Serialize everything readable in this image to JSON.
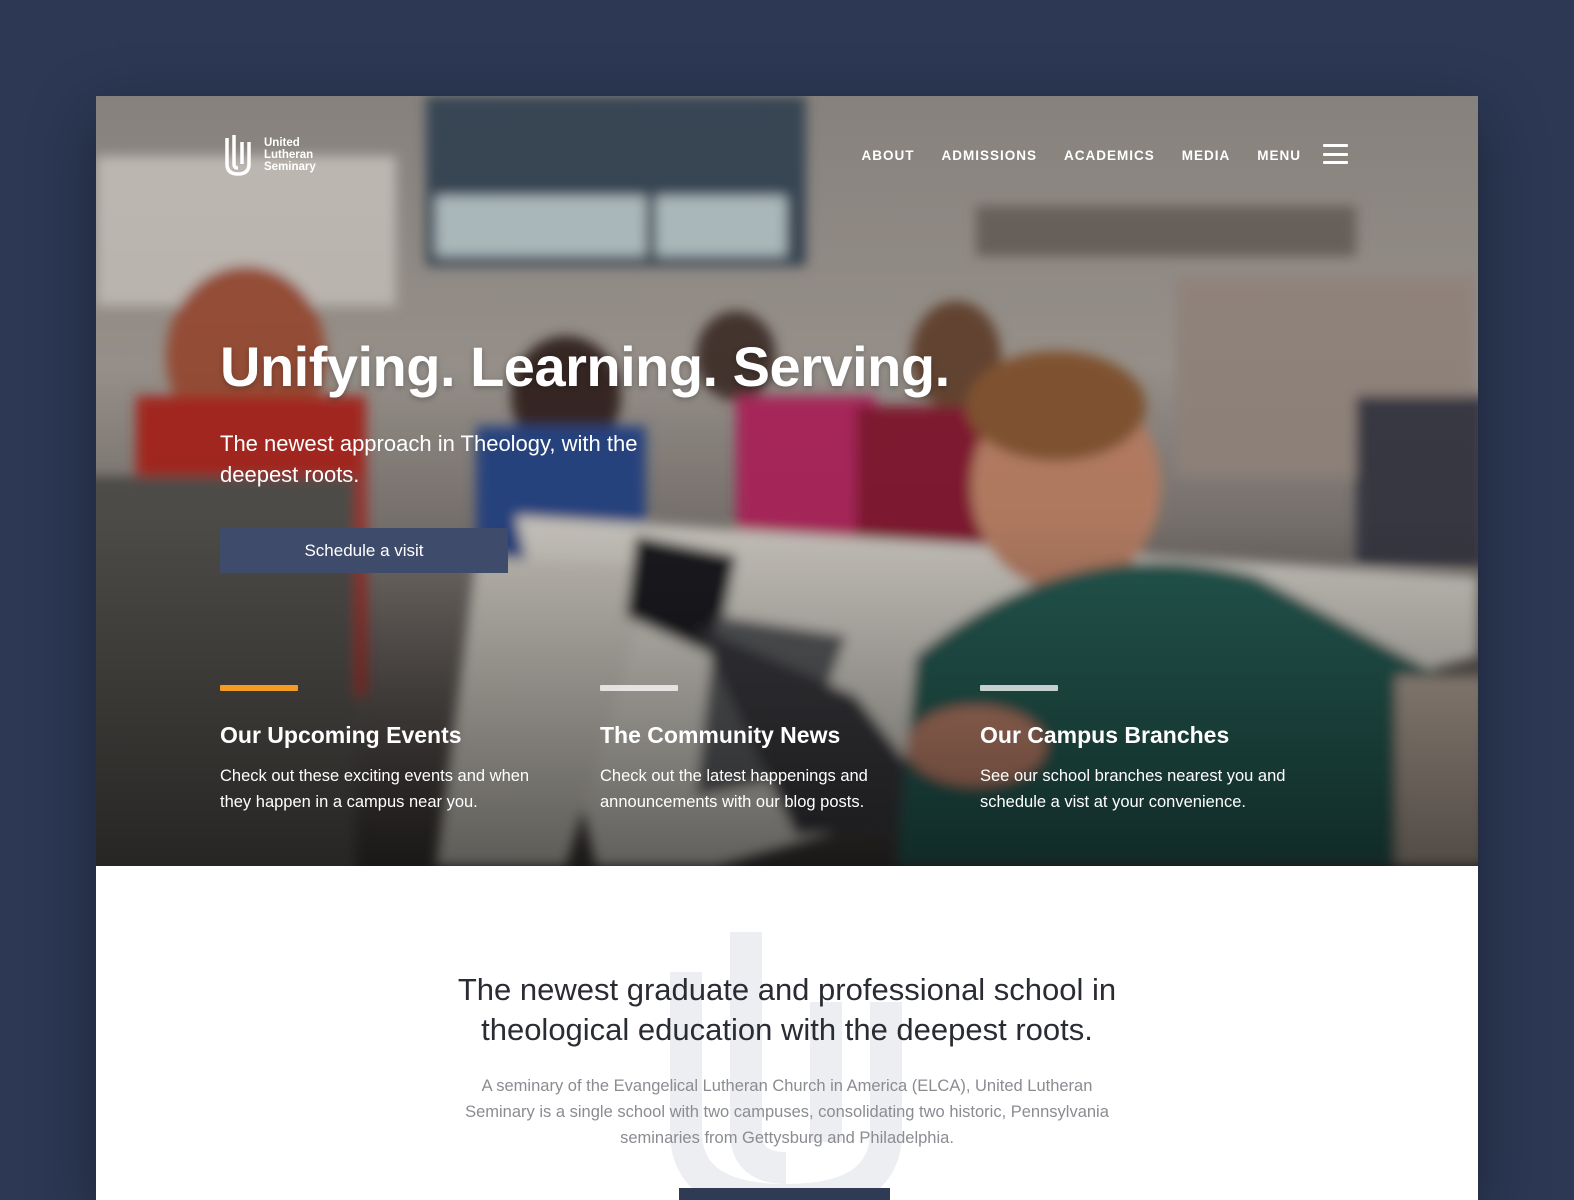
{
  "header": {
    "logo_text": [
      "United",
      "Lutheran",
      "Seminary"
    ],
    "nav": [
      {
        "label": "ABOUT"
      },
      {
        "label": "ADMISSIONS"
      },
      {
        "label": "ACADEMICS"
      },
      {
        "label": "MEDIA"
      }
    ],
    "menu_label": "MENU",
    "menu_icon": "hamburger-icon"
  },
  "hero": {
    "title": "Unifying. Learning. Serving.",
    "subtitle": "The newest approach in Theology, with the deepest roots.",
    "cta_label": "Schedule a visit"
  },
  "features": [
    {
      "title": "Our Upcoming Events",
      "description": "Check out these exciting events and when they happen in a campus near you.",
      "active": true
    },
    {
      "title": "The Community News",
      "description": "Check out the latest happenings and announcements with our blog posts.",
      "active": false
    },
    {
      "title": "Our Campus Branches",
      "description": "See our school branches nearest you and schedule a vist at your convenience.",
      "active": false
    }
  ],
  "intro": {
    "heading": "The newest graduate and professional school in theological education with the deepest roots.",
    "text": "A seminary of the Evangelical Lutheran Church in America (ELCA), United Lutheran Seminary is a single school with two campuses, consolidating two historic, Pennsylvania seminaries from Gettysburg and Philadelphia."
  },
  "colors": {
    "page_background": "#2c3854",
    "accent": "#f39c21",
    "button": "#3e4b6a",
    "intro_button": "#2f3a55"
  }
}
